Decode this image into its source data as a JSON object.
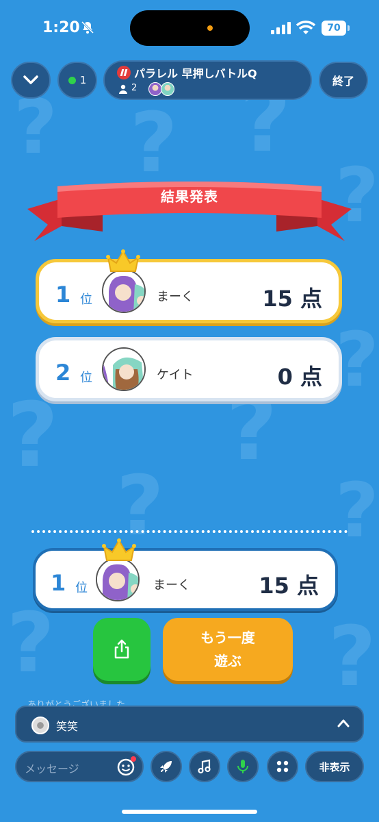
{
  "status_bar": {
    "time": "1:20",
    "battery": "70"
  },
  "header": {
    "online_count": "1",
    "room_title": "パラレル 早押しバトルQ",
    "member_count": "2",
    "end_label": "終了"
  },
  "results": {
    "title": "結果発表",
    "rank_suffix": "位",
    "score_suffix": "点",
    "entries": [
      {
        "rank": "1",
        "name": "まーく",
        "score": "15"
      },
      {
        "rank": "2",
        "name": "ケイト",
        "score": "0"
      }
    ],
    "my_result": {
      "rank": "1",
      "name": "まーく",
      "score": "15"
    }
  },
  "actions": {
    "play_again_line1": "もう一度",
    "play_again_line2": "遊ぶ"
  },
  "chat": {
    "latest_message": "笑笑",
    "previous_message": "ありがとうございました"
  },
  "bottom_bar": {
    "message_placeholder": "メッセージ",
    "hide_label": "非表示"
  },
  "colors": {
    "background": "#2f95e0",
    "gold": "#f6c83a",
    "share_green": "#27c53f",
    "again_orange": "#f6a91f",
    "ribbon_red": "#f0474b"
  }
}
